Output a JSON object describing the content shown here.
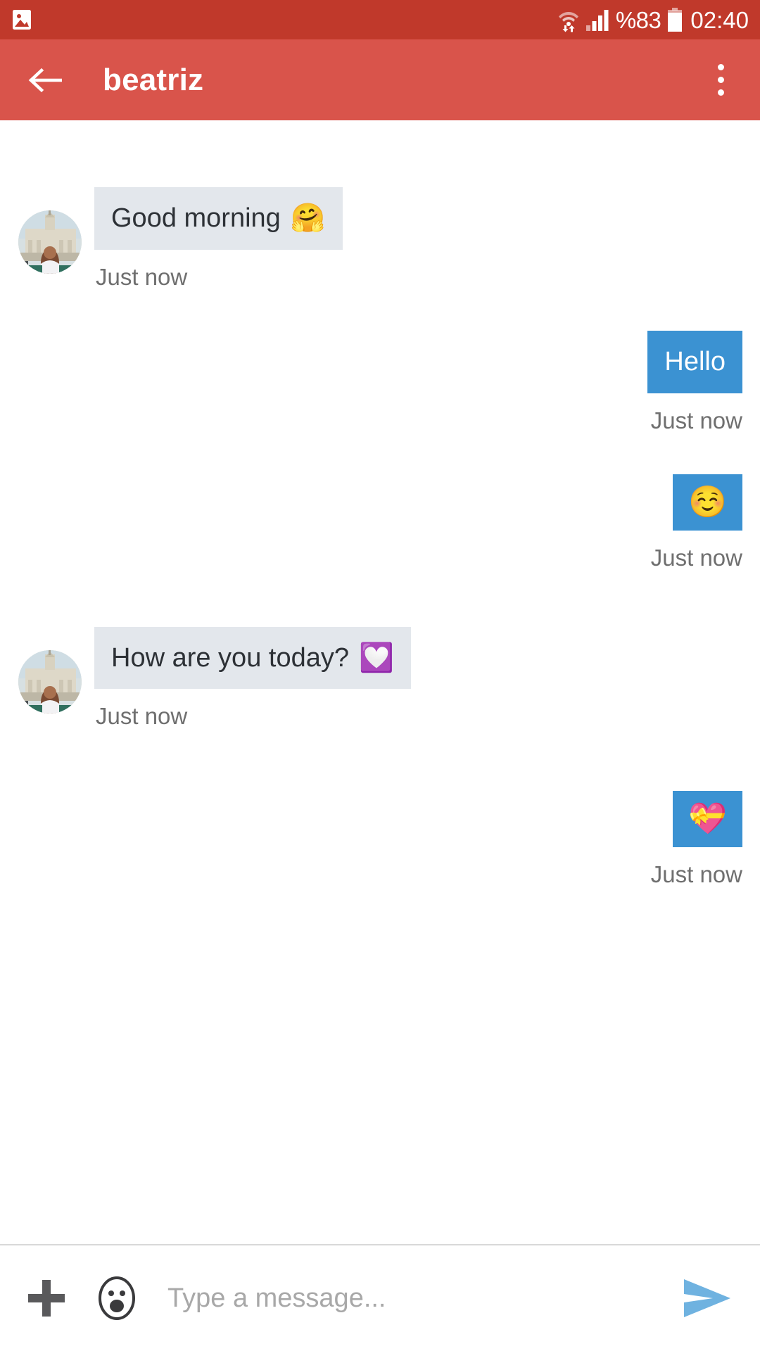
{
  "status_bar": {
    "background_color": "#c0392b",
    "left_icons": [
      {
        "name": "gallery-image-icon",
        "glyph": "image"
      }
    ],
    "wifi_icon": "wifi-data-transfer-icon",
    "signal_icon": "cellular-signal-icon",
    "battery_percent": "%83",
    "battery_icon": "battery-icon",
    "clock": "02:40"
  },
  "app_bar": {
    "background_color": "#d9544b",
    "back_label": "back-arrow",
    "title": "beatriz",
    "overflow_label": "more-options"
  },
  "chat": {
    "incoming_bubble_color": "#e3e7ec",
    "outgoing_bubble_color": "#3b92d2",
    "messages": [
      {
        "id": "m1",
        "direction": "incoming",
        "text": "Good morning",
        "emoji": "🤗",
        "emoji_name": "hugging-face-emoji",
        "timestamp": "Just now",
        "has_avatar": true,
        "emoji_only": false
      },
      {
        "id": "m2",
        "direction": "outgoing",
        "text": "Hello",
        "emoji": "",
        "emoji_name": "",
        "timestamp": "Just now",
        "has_avatar": false,
        "emoji_only": false
      },
      {
        "id": "m3",
        "direction": "outgoing",
        "text": "",
        "emoji": "☺️",
        "emoji_name": "smiling-face-emoji",
        "timestamp": "Just now",
        "has_avatar": false,
        "emoji_only": true
      },
      {
        "id": "m4",
        "direction": "incoming",
        "text": "How are you today?",
        "emoji": "💟",
        "emoji_name": "heart-decoration-emoji",
        "timestamp": "Just now",
        "has_avatar": true,
        "emoji_only": false
      },
      {
        "id": "m5",
        "direction": "outgoing",
        "text": "",
        "emoji": "💝",
        "emoji_name": "heart-with-ribbon-emoji",
        "timestamp": "Just now",
        "has_avatar": false,
        "emoji_only": true
      }
    ]
  },
  "input_bar": {
    "attach_label": "add-attachment",
    "emoji_label": "insert-emoji",
    "placeholder": "Type a message...",
    "value": "",
    "send_label": "send-message",
    "send_color": "#6fb2e0"
  }
}
